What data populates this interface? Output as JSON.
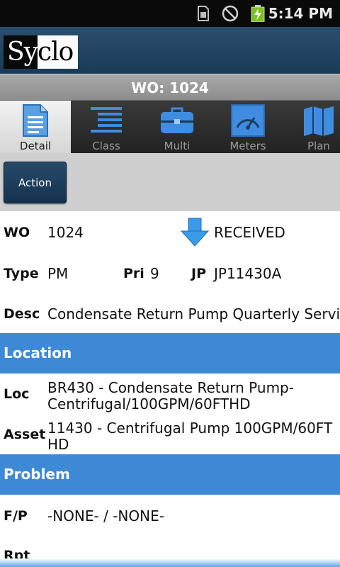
{
  "status_bar": {
    "time": "5:14 PM",
    "icons": [
      "sim-card-icon",
      "no-signal-icon",
      "battery-charging-icon"
    ]
  },
  "header": {
    "logo_part1": "Sy",
    "logo_part2": "clo"
  },
  "title_bar": {
    "text": "WO: 1024"
  },
  "tabs": [
    {
      "label": "Detail",
      "icon": "document-icon",
      "active": true
    },
    {
      "label": "Class",
      "icon": "list-lines-icon",
      "active": false
    },
    {
      "label": "Multi",
      "icon": "toolbox-icon",
      "active": false
    },
    {
      "label": "Meters",
      "icon": "gauge-icon",
      "active": false
    },
    {
      "label": "Plan",
      "icon": "map-icon",
      "active": false
    }
  ],
  "action_button": {
    "label": "Action"
  },
  "details": {
    "wo_label": "WO",
    "wo_value": "1024",
    "status_icon": "down-arrow-icon",
    "status_value": "RECEIVED",
    "type_label": "Type",
    "type_value": "PM",
    "pri_label": "Pri",
    "pri_value": "9",
    "jp_label": "JP",
    "jp_value": "JP11430A",
    "desc_label": "Desc",
    "desc_value": "Condensate Return Pump Quarterly Service"
  },
  "location_section": {
    "title": "Location",
    "loc_label": "Loc",
    "loc_line1": "BR430 - Condensate Return Pump-",
    "loc_line2": "Centrifugal/100GPM/60FTHD",
    "asset_label": "Asset",
    "asset_line1": "11430 - Centrifugal Pump 100GPM/60FT",
    "asset_line2": "HD"
  },
  "problem_section": {
    "title": "Problem",
    "fp_label": "F/P",
    "fp_value": "-NONE- / -NONE-",
    "rpt_label": "Rpt"
  },
  "colors": {
    "section_header": "#3e89d6",
    "header_bg": "#1f4262",
    "action_button": "#1c3b5a"
  }
}
